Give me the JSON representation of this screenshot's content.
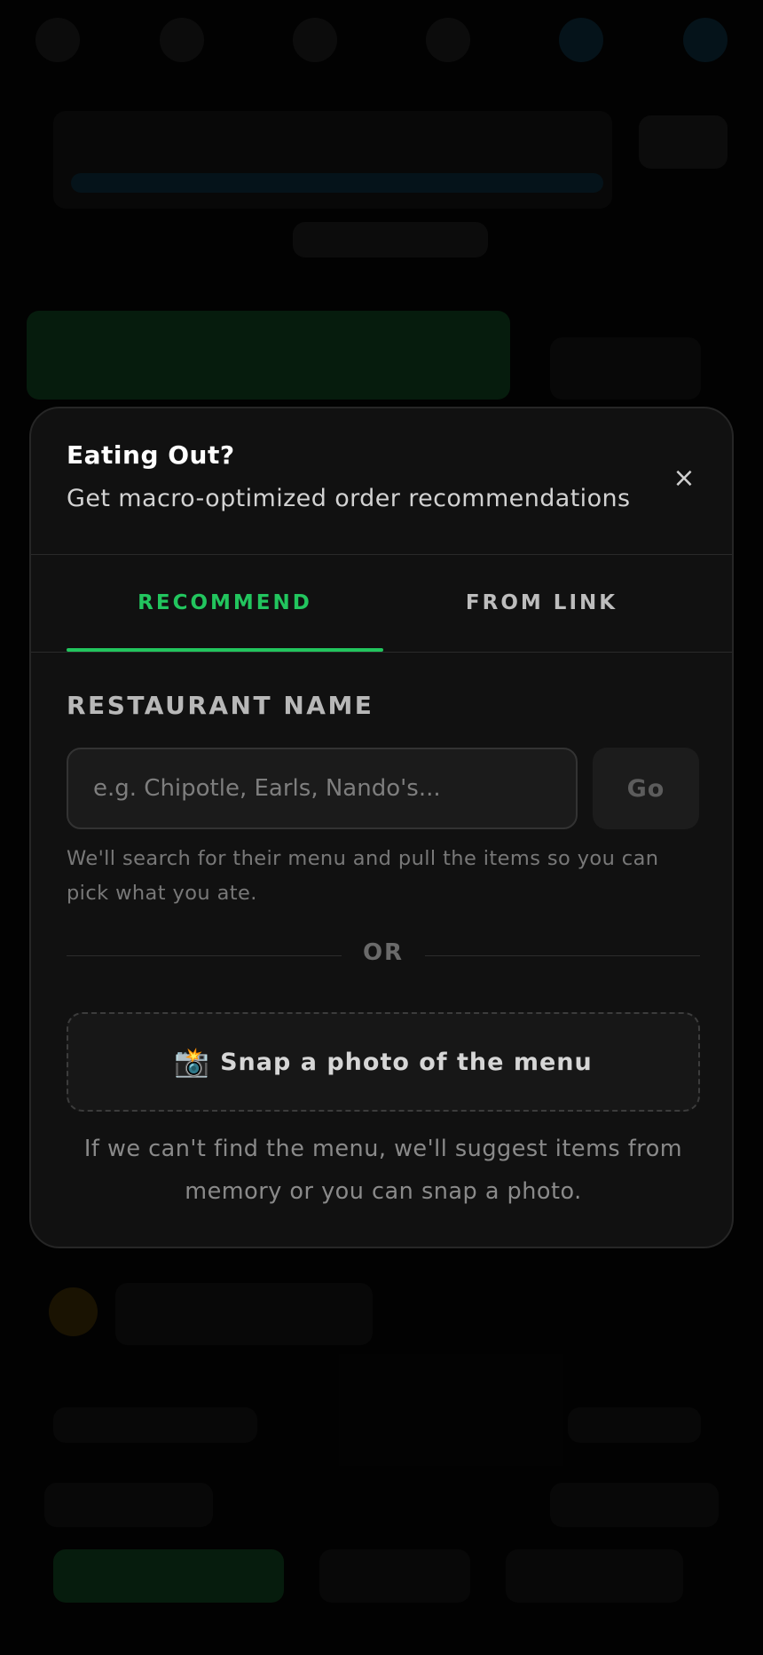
{
  "modal": {
    "title": "Eating Out?",
    "subtitle": "Get macro-optimized order recommendations",
    "close_label": "×",
    "tabs": [
      {
        "label": "RECOMMEND",
        "active": true
      },
      {
        "label": "FROM LINK",
        "active": false
      }
    ],
    "restaurant": {
      "label": "RESTAURANT NAME",
      "placeholder": "e.g. Chipotle, Earls, Nando's...",
      "value": "",
      "go_label": "Go",
      "helper": "We'll search for their menu and pull the items so you can pick what you ate."
    },
    "divider_text": "OR",
    "snap": {
      "icon": "camera-flash-icon",
      "icon_glyph": "📸",
      "label": "Snap a photo of the menu"
    },
    "footnote": "If we can't find the menu, we'll suggest items from memory or you can snap a photo."
  },
  "colors": {
    "accent": "#22c55e",
    "modal_bg": "#111111",
    "page_bg": "#000000"
  }
}
